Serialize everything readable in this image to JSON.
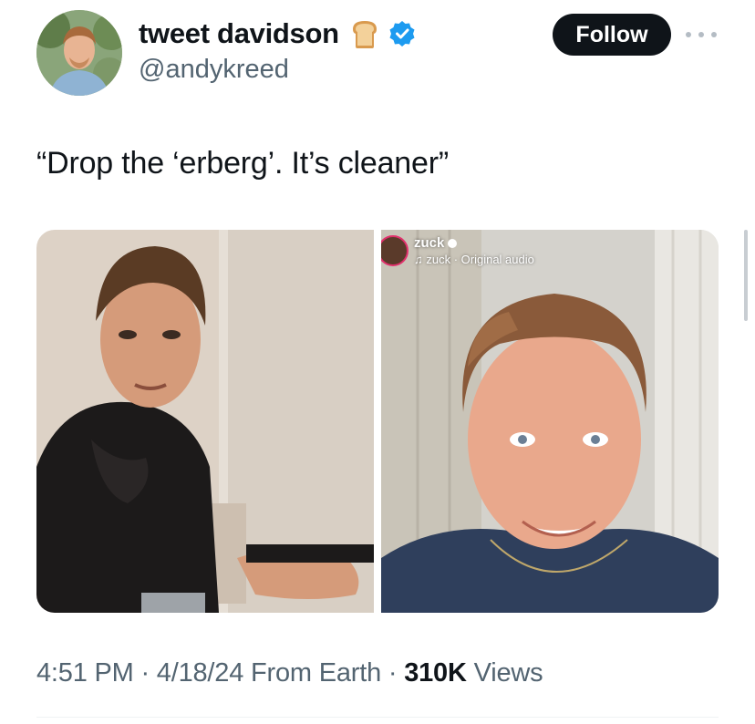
{
  "author": {
    "display_name": "tweet davidson",
    "handle": "@andykreed",
    "emoji_icon": "bread-icon",
    "verified_icon": "verified-badge-icon",
    "verified_color": "#1d9bf0"
  },
  "actions": {
    "follow_label": "Follow",
    "more_icon": "more-options-icon"
  },
  "tweet": {
    "text": "“Drop the ‘erberg’. It’s cleaner”"
  },
  "media": {
    "reel": {
      "username": "zuck",
      "audio": "♫ zuck · Original audio"
    }
  },
  "meta": {
    "time": "4:51 PM",
    "separator": " · ",
    "date": "4/18/24",
    "source": "From Earth",
    "views_count": "310K",
    "views_label": "Views"
  },
  "colors": {
    "text_primary": "#0f1419",
    "text_secondary": "#536471",
    "follow_bg": "#0f1419"
  }
}
